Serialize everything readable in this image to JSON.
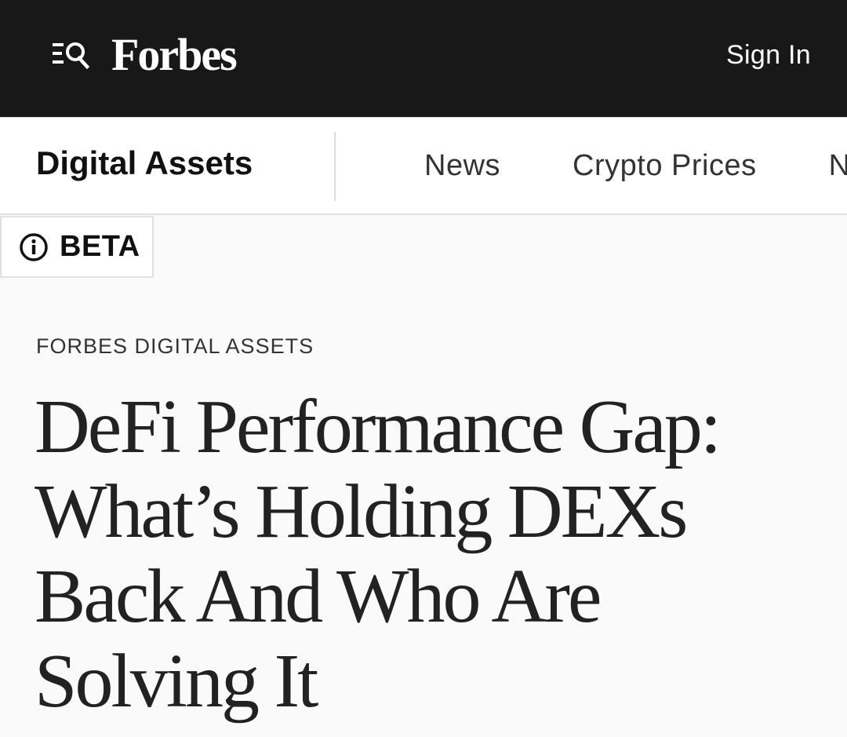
{
  "header": {
    "brand": "Forbes",
    "sign_in_label": "Sign In",
    "menu_search_icon": "menu-search-icon",
    "background_color": "#181818"
  },
  "nav": {
    "section_title": "Digital Assets",
    "links": [
      {
        "label": "News"
      },
      {
        "label": "Crypto Prices"
      },
      {
        "label": "N"
      }
    ]
  },
  "badge": {
    "icon": "info-icon",
    "label": "BETA"
  },
  "article": {
    "kicker": "FORBES DIGITAL ASSETS",
    "headline": "DeFi Performance Gap: What’s Holding DEXs Back And Who Are Solving It"
  }
}
